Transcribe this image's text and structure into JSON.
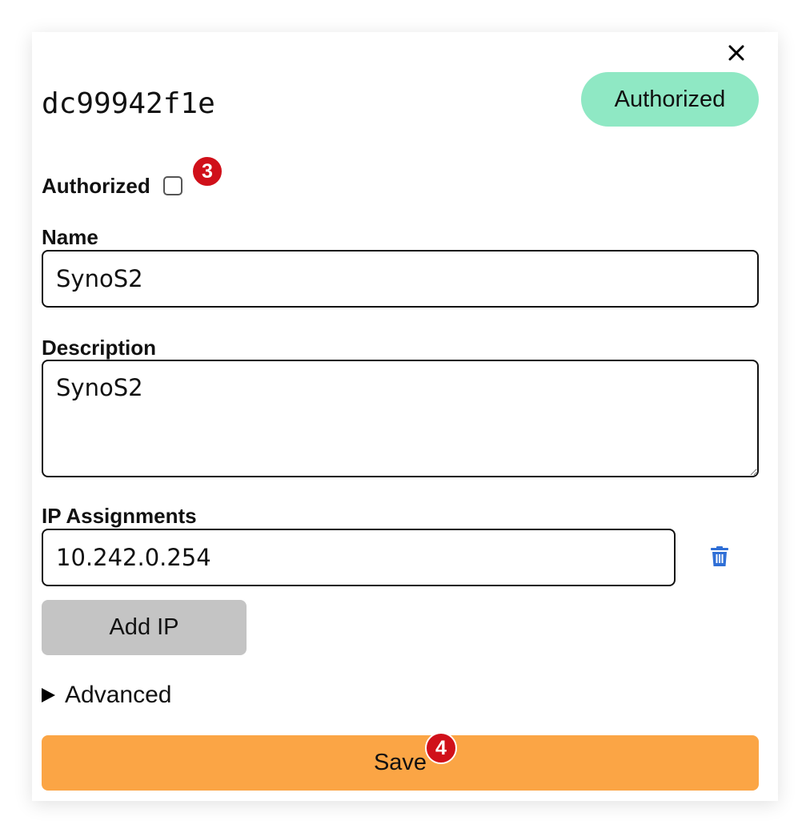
{
  "dialog": {
    "device_id": "dc99942f1e",
    "status_badge": "Authorized",
    "authorized_label": "Authorized",
    "authorized_checked": false,
    "name_label": "Name",
    "name_value": "SynoS2",
    "description_label": "Description",
    "description_value": "SynoS2",
    "ip_label": "IP Assignments",
    "ip_value": "10.242.0.254",
    "add_ip_label": "Add IP",
    "advanced_label": "Advanced",
    "save_label": "Save"
  },
  "markers": {
    "authorized": "3",
    "save": "4"
  },
  "icons": {
    "close": "close-icon",
    "delete": "trash-icon",
    "disclosure": "triangle-right-icon"
  },
  "colors": {
    "status_badge": "#8fe8c4",
    "save_button": "#fba545",
    "add_ip_button": "#c4c4c4",
    "trash_icon": "#2f6fd6",
    "marker": "#d0101a"
  }
}
